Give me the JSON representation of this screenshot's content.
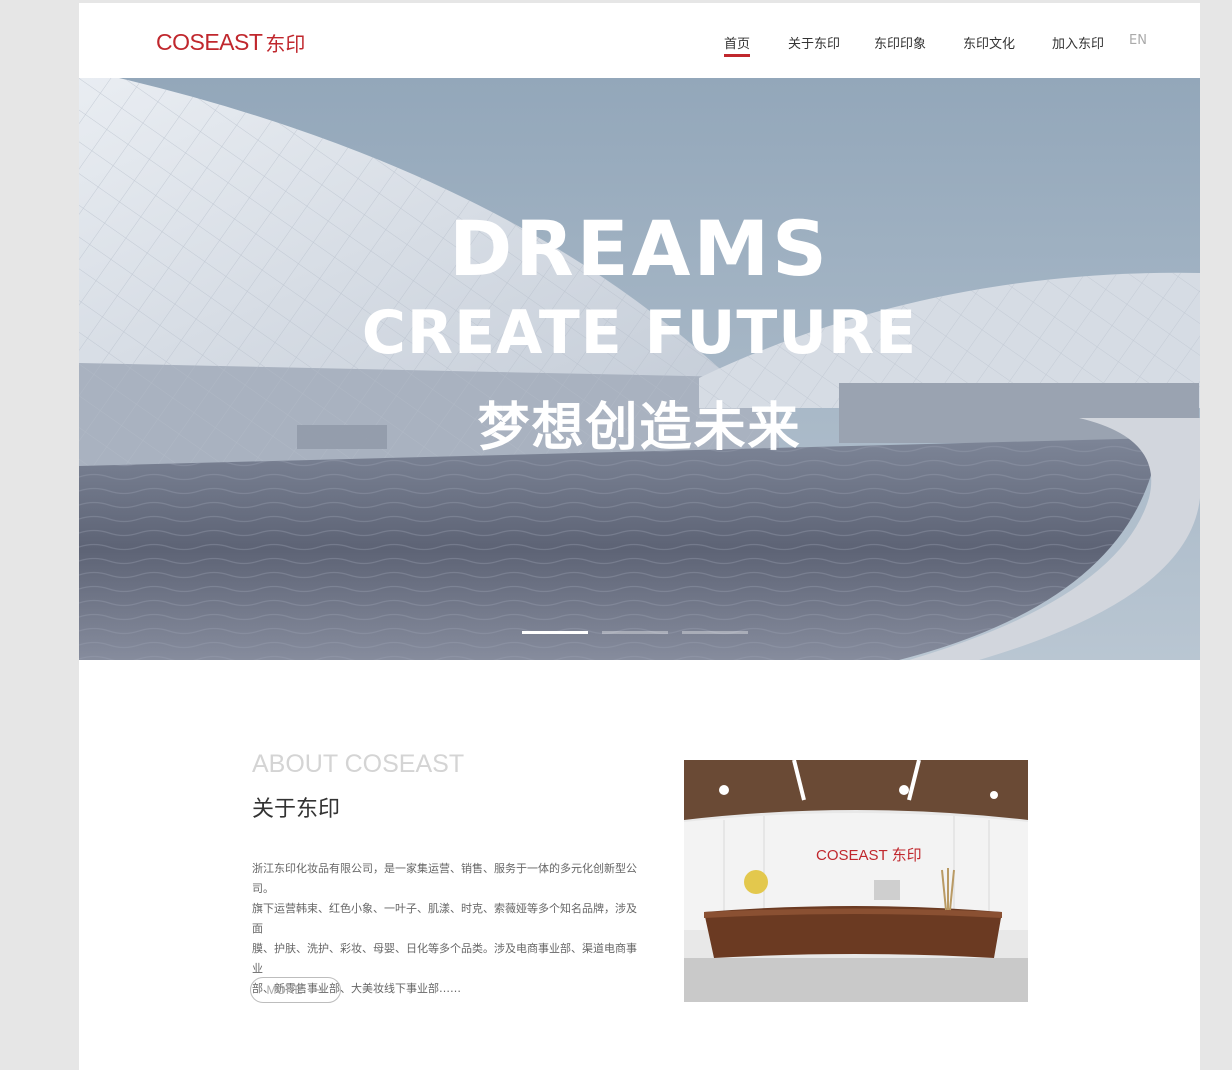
{
  "header": {
    "logo_en": "COSEAST",
    "logo_cn": "东印",
    "nav": [
      {
        "label": "首页",
        "active": true
      },
      {
        "label": "关于东印",
        "active": false
      },
      {
        "label": "东印印象",
        "active": false
      },
      {
        "label": "东印文化",
        "active": false
      },
      {
        "label": "加入东印",
        "active": false
      }
    ],
    "lang": "EN"
  },
  "hero": {
    "line1": "DREAMS",
    "line2": "CREATE FUTURE",
    "line3": "梦想创造未来",
    "slides_total": 3,
    "slide_active": 1
  },
  "about": {
    "title_en": "ABOUT COSEAST",
    "title_cn": "关于东印",
    "paragraph_lines": [
      "浙江东印化妆品有限公司，是一家集运营、销售、服务于一体的多元化创新型公司。",
      "旗下运营韩束、红色小象、一叶子、肌漾、时克、索薇娅等多个知名品牌，涉及面",
      "膜、护肤、洗护、彩妆、母婴、日化等多个品类。涉及电商事业部、渠道电商事业",
      "部、新零售事业部、大美妆线下事业部……"
    ],
    "more_label": "MORE",
    "photo_sign": "COSEAST 东印"
  },
  "colors": {
    "brand": "#c0272d",
    "page_bg": "#e6e6e6"
  }
}
